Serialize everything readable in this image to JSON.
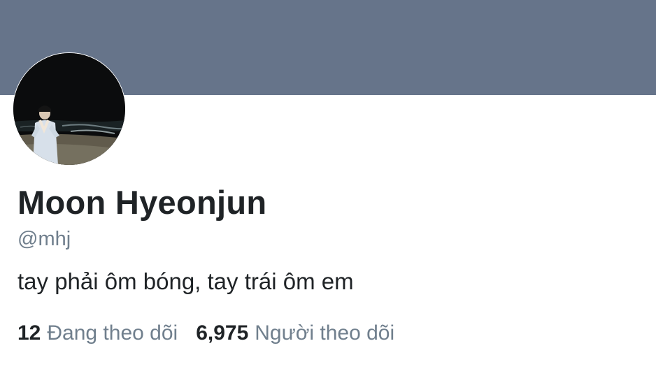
{
  "profile": {
    "display_name": "Moon Hyeonjun",
    "handle": "@mhj",
    "bio": "tay phải ôm bóng, tay trái ôm em",
    "avatar_icon": "profile-photo",
    "banner_color": "#66748a"
  },
  "stats": {
    "following_count": "12",
    "following_label": "Đang theo dõi",
    "followers_count": "6,975",
    "followers_label": "Người theo dõi"
  }
}
